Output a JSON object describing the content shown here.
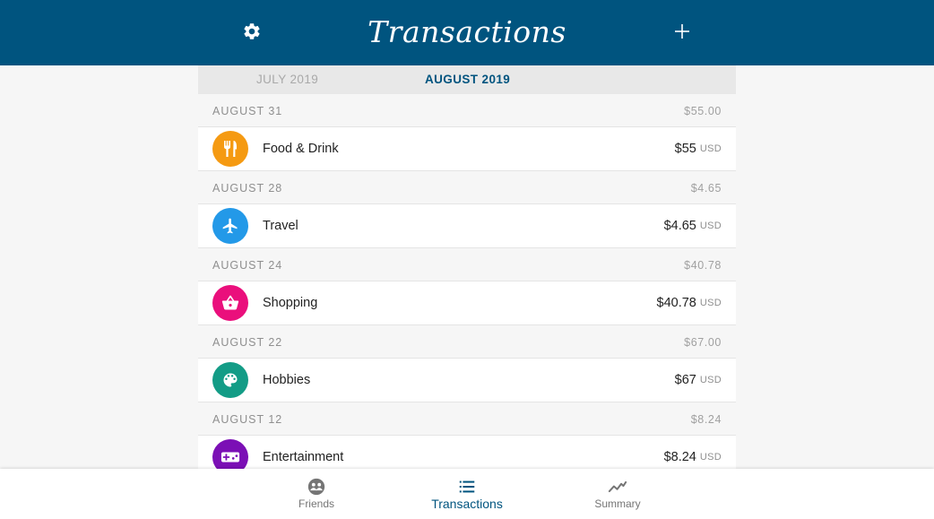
{
  "header": {
    "title": "Transactions",
    "settings_icon": "gear-icon",
    "add_icon": "plus-icon"
  },
  "months": {
    "previous": "JULY 2019",
    "current": "AUGUST 2019"
  },
  "days": [
    {
      "date": "AUGUST 31",
      "total": "$55.00",
      "transactions": [
        {
          "category": "Food & Drink",
          "icon": "fork-knife-icon",
          "color": "#f59a12",
          "amount": "$55",
          "currency": "USD"
        }
      ]
    },
    {
      "date": "AUGUST 28",
      "total": "$4.65",
      "transactions": [
        {
          "category": "Travel",
          "icon": "airplane-icon",
          "color": "#2399e8",
          "amount": "$4.65",
          "currency": "USD"
        }
      ]
    },
    {
      "date": "AUGUST 24",
      "total": "$40.78",
      "transactions": [
        {
          "category": "Shopping",
          "icon": "basket-icon",
          "color": "#ea0f7c",
          "amount": "$40.78",
          "currency": "USD"
        }
      ]
    },
    {
      "date": "AUGUST 22",
      "total": "$67.00",
      "transactions": [
        {
          "category": "Hobbies",
          "icon": "palette-icon",
          "color": "#139c86",
          "amount": "$67",
          "currency": "USD"
        }
      ]
    },
    {
      "date": "AUGUST 12",
      "total": "$8.24",
      "transactions": [
        {
          "category": "Entertainment",
          "icon": "gamepad-icon",
          "color": "#7b0fb5",
          "amount": "$8.24",
          "currency": "USD"
        }
      ]
    }
  ],
  "bottom_nav": [
    {
      "label": "Friends",
      "icon": "friends-icon",
      "active": false
    },
    {
      "label": "Transactions",
      "icon": "list-icon",
      "active": true
    },
    {
      "label": "Summary",
      "icon": "trend-line-icon",
      "active": false
    }
  ],
  "colors": {
    "primary": "#00547f",
    "background": "#f6f6f6",
    "tab_bar": "#e8e8e8"
  }
}
